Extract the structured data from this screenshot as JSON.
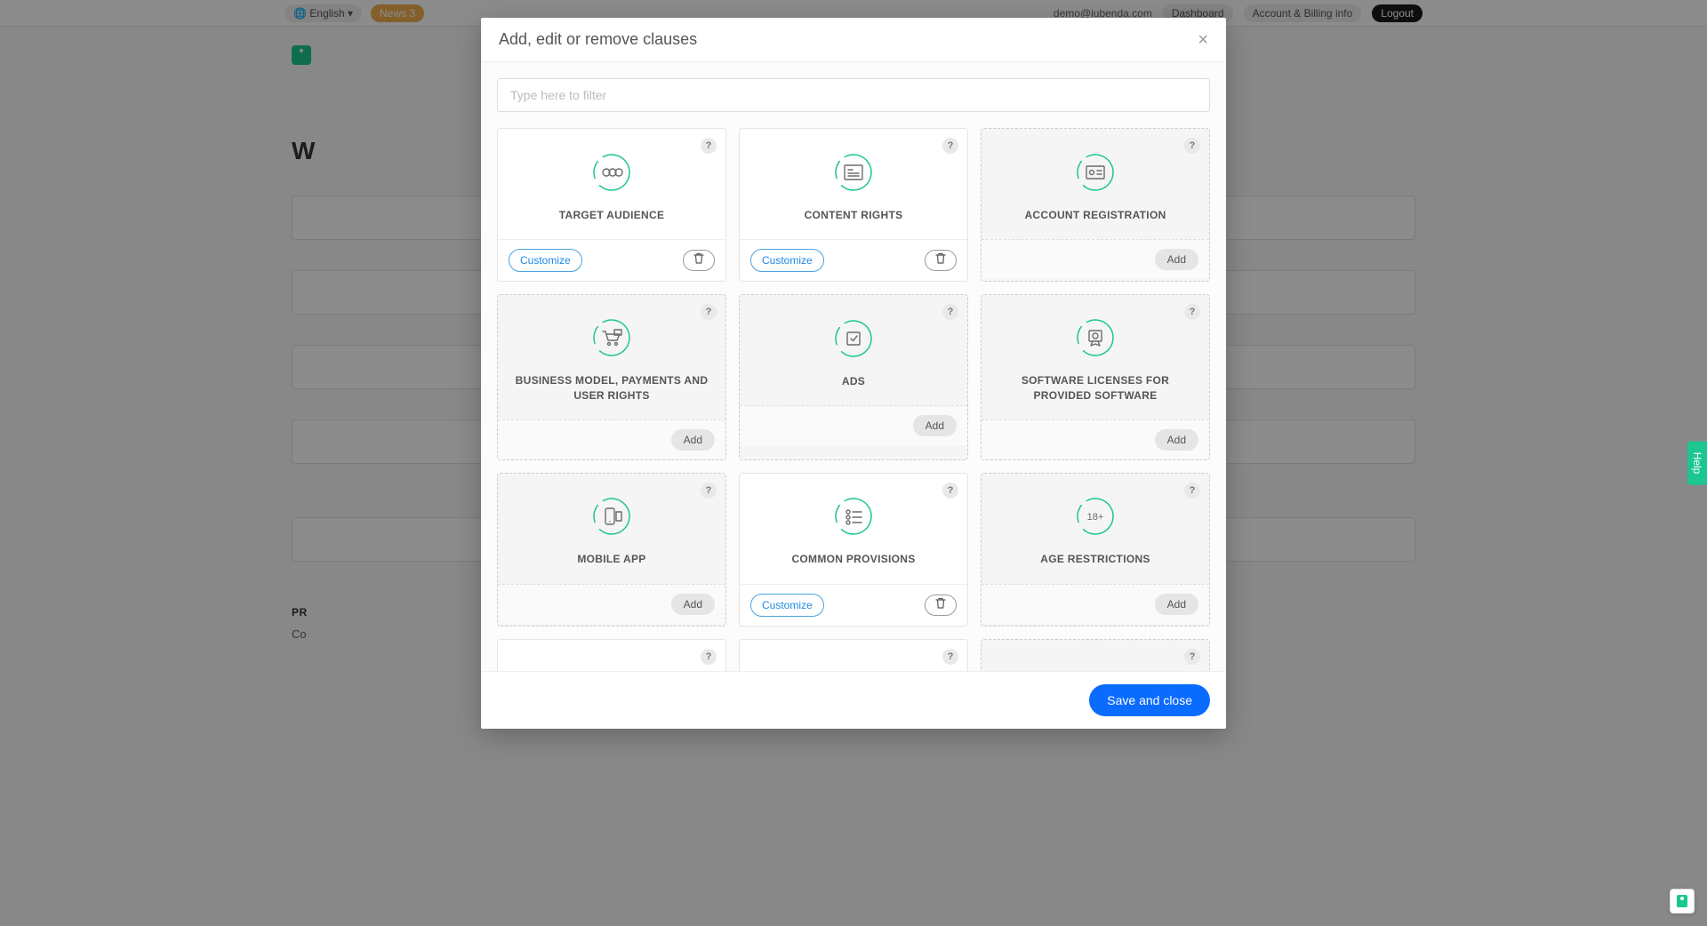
{
  "topbar": {
    "language": "English",
    "news_badge": "News 3",
    "email": "demo@iubenda.com",
    "nav": [
      "Dashboard",
      "Account & Billing info"
    ],
    "logout": "Logout"
  },
  "bg": {
    "heading_fragment": "W",
    "section_label": "PR",
    "section_sub": "Co"
  },
  "modal": {
    "title": "Add, edit or remove clauses",
    "filter_placeholder": "Type here to filter",
    "help_glyph": "?",
    "customize_label": "Customize",
    "add_label": "Add",
    "save_label": "Save and close"
  },
  "cards": [
    {
      "title": "TARGET AUDIENCE",
      "active": true,
      "icon": "group"
    },
    {
      "title": "CONTENT RIGHTS",
      "active": true,
      "icon": "doc-lines"
    },
    {
      "title": "ACCOUNT REGISTRATION",
      "active": false,
      "icon": "id-card"
    },
    {
      "title": "BUSINESS MODEL, PAYMENTS AND USER RIGHTS",
      "active": false,
      "icon": "cart"
    },
    {
      "title": "ADS",
      "active": false,
      "icon": "check-box"
    },
    {
      "title": "SOFTWARE LICENSES FOR PROVIDED SOFTWARE",
      "active": false,
      "icon": "badge"
    },
    {
      "title": "MOBILE APP",
      "active": false,
      "icon": "phone"
    },
    {
      "title": "COMMON PROVISIONS",
      "active": true,
      "icon": "list-check"
    },
    {
      "title": "AGE RESTRICTIONS",
      "active": false,
      "icon": "age"
    },
    {
      "title": "",
      "active": true,
      "icon": "doc-block"
    },
    {
      "title": "",
      "active": true,
      "icon": "person-check"
    },
    {
      "title": "",
      "active": false,
      "icon": "gear-doc"
    }
  ],
  "help_tab": "Help"
}
